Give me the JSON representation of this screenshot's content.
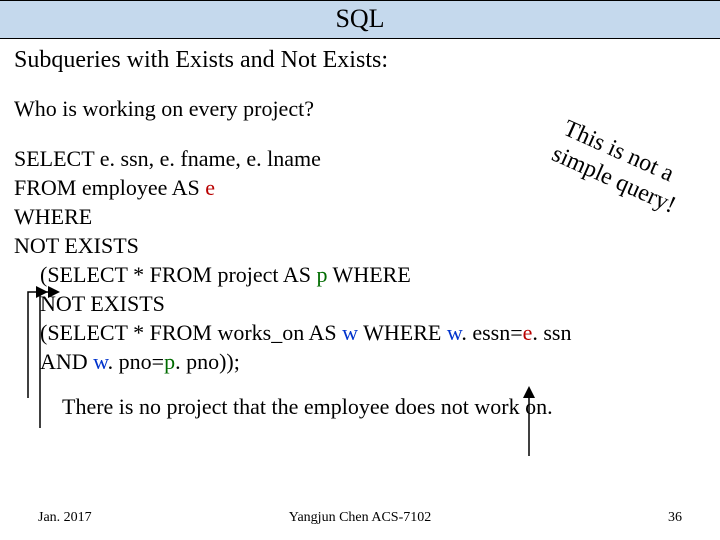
{
  "title": "SQL",
  "subtitle": "Subqueries with Exists and Not Exists:",
  "question": "Who is working on every project?",
  "note_line1": "This is not a",
  "note_line2": "simple query!",
  "sql": {
    "l1a": "SELECT e. ssn, e. fname, e. lname",
    "l2a": "FROM employee AS ",
    "l2b": "e",
    "l3": "WHERE",
    "l4": "NOT EXISTS",
    "l5a": "(SELECT * FROM project AS ",
    "l5b": "p",
    "l5c": " WHERE",
    "l6": "NOT EXISTS",
    "l7a": "(SELECT * FROM works_on AS ",
    "l7b": "w",
    "l7c": " WHERE ",
    "l7d": "w",
    "l7e": ". essn=",
    "l7f": "e",
    "l7g": ". ssn",
    "l8a": "AND ",
    "l8b": "w",
    "l8c": ". pno=",
    "l8d": "p",
    "l8e": ". pno));"
  },
  "caption": "There is no project that the employee does not work on.",
  "footer": {
    "left": "Jan. 2017",
    "mid": "Yangjun Chen        ACS-7102",
    "right": "36"
  }
}
